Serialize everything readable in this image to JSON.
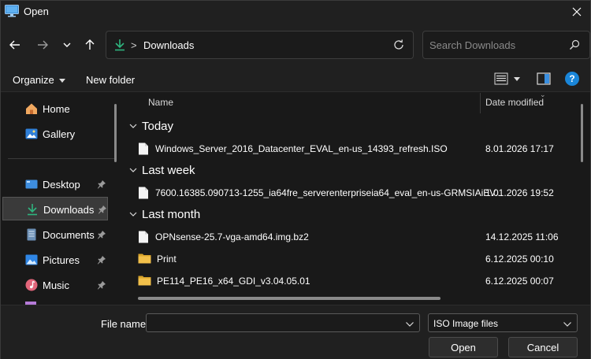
{
  "window": {
    "title": "Open",
    "close_icon": "close-icon"
  },
  "nav": {
    "back_icon": "arrow-left-icon",
    "forward_icon": "arrow-right-icon",
    "recent_icon": "chevron-down-icon",
    "up_icon": "arrow-up-icon",
    "address": {
      "crumb": "Downloads",
      "separator": ">"
    },
    "refresh_icon": "refresh-icon",
    "search_placeholder": "Search Downloads"
  },
  "toolbar": {
    "organize_label": "Organize",
    "new_folder_label": "New folder",
    "help_label": "?"
  },
  "sidebar": {
    "items": [
      {
        "label": "Home",
        "icon": "home-icon"
      },
      {
        "label": "Gallery",
        "icon": "gallery-icon"
      },
      {
        "label": "Desktop",
        "icon": "desktop-icon",
        "pinned": true
      },
      {
        "label": "Downloads",
        "icon": "download-icon",
        "pinned": true,
        "selected": true
      },
      {
        "label": "Documents",
        "icon": "documents-icon",
        "pinned": true
      },
      {
        "label": "Pictures",
        "icon": "pictures-icon",
        "pinned": true
      },
      {
        "label": "Music",
        "icon": "music-icon",
        "pinned": true
      }
    ]
  },
  "columns": {
    "name": "Name",
    "date": "Date modified"
  },
  "groups": [
    {
      "label": "Today"
    },
    {
      "label": "Last week"
    },
    {
      "label": "Last month"
    }
  ],
  "files": [
    {
      "name": "Windows_Server_2016_Datacenter_EVAL_en-us_14393_refresh.ISO",
      "date": "8.01.2026 17:17",
      "type": "file"
    },
    {
      "name": "7600.16385.090713-1255_ia64fre_serverenterpriseia64_eval_en-us-GRMSIAiEV...",
      "date": "1.01.2026 19:52",
      "type": "file"
    },
    {
      "name": "OPNsense-25.7-vga-amd64.img.bz2",
      "date": "14.12.2025 11:06",
      "type": "file"
    },
    {
      "name": "Print",
      "date": "6.12.2025 00:10",
      "type": "folder"
    },
    {
      "name": "PE114_PE16_x64_GDI_v3.04.05.01",
      "date": "6.12.2025 00:07",
      "type": "folder"
    }
  ],
  "bottom": {
    "file_name_label": "File name:",
    "file_name_value": "",
    "file_type": "ISO Image files",
    "open_label": "Open",
    "cancel_label": "Cancel"
  },
  "colors": {
    "accent_green": "#2fb57f",
    "folder_yellow": "#f2c04a",
    "help_blue": "#1a86d9"
  }
}
